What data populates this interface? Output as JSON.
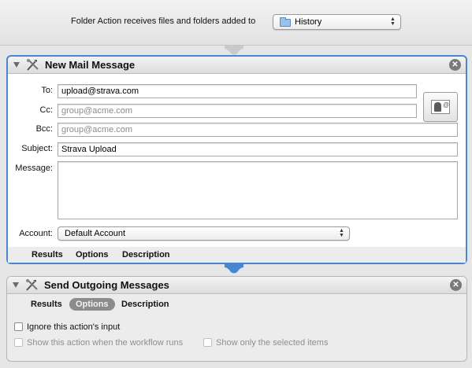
{
  "workflow": {
    "label": "Folder Action receives files and folders added to",
    "folder": "History"
  },
  "mail_action": {
    "title": "New Mail Message",
    "to_label": "To:",
    "to_value": "upload@strava.com",
    "cc_label": "Cc:",
    "cc_placeholder": "group@acme.com",
    "bcc_label": "Bcc:",
    "bcc_placeholder": "group@acme.com",
    "subject_label": "Subject:",
    "subject_value": "Strava Upload",
    "message_label": "Message:",
    "message_value": "",
    "account_label": "Account:",
    "account_value": "Default Account",
    "tabs": [
      "Results",
      "Options",
      "Description"
    ]
  },
  "send_action": {
    "title": "Send Outgoing Messages",
    "tabs": [
      "Results",
      "Options",
      "Description"
    ],
    "active_tab": "Options",
    "ignore_input_label": "Ignore this action's input",
    "show_when_runs_label": "Show this action when the workflow runs",
    "show_selected_label": "Show only the selected items"
  },
  "colors": {
    "selection_border": "#4a86d0",
    "panel_background": "#ececec"
  }
}
